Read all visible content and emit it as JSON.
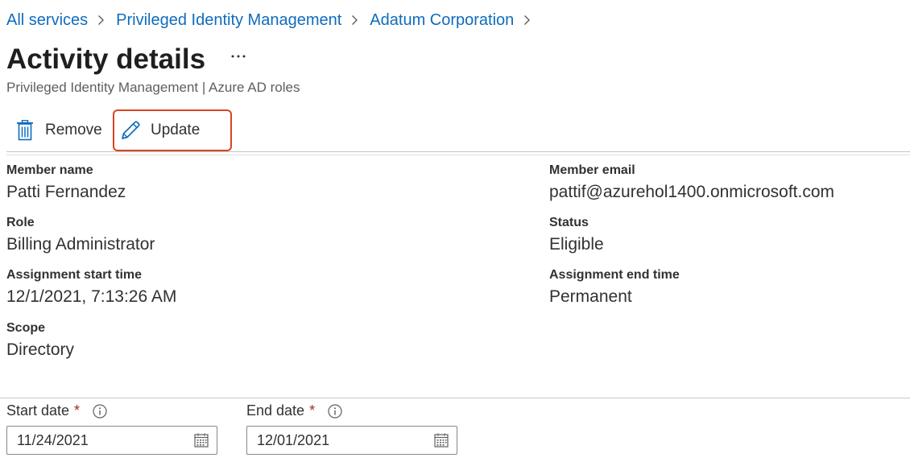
{
  "breadcrumb": {
    "items": [
      "All services",
      "Privileged Identity Management",
      "Adatum Corporation"
    ]
  },
  "header": {
    "title": "Activity details",
    "more_label": "...",
    "subtitle": "Privileged Identity Management | Azure AD roles"
  },
  "toolbar": {
    "remove_label": "Remove",
    "update_label": "Update"
  },
  "details": {
    "member_name": {
      "label": "Member name",
      "value": "Patti Fernandez"
    },
    "member_email": {
      "label": "Member email",
      "value": "pattif@azurehol1400.onmicrosoft.com"
    },
    "role": {
      "label": "Role",
      "value": "Billing Administrator"
    },
    "status": {
      "label": "Status",
      "value": "Eligible"
    },
    "assignment_start": {
      "label": "Assignment start time",
      "value": "12/1/2021, 7:13:26 AM"
    },
    "assignment_end": {
      "label": "Assignment end time",
      "value": "Permanent"
    },
    "scope": {
      "label": "Scope",
      "value": "Directory"
    }
  },
  "form": {
    "start_date": {
      "label": "Start date",
      "required_mark": "*",
      "value": "11/24/2021"
    },
    "end_date": {
      "label": "End date",
      "required_mark": "*",
      "value": "12/01/2021"
    }
  },
  "colors": {
    "link": "#0f6cbd",
    "highlight_border": "#d9441f",
    "required": "#a4262c"
  }
}
